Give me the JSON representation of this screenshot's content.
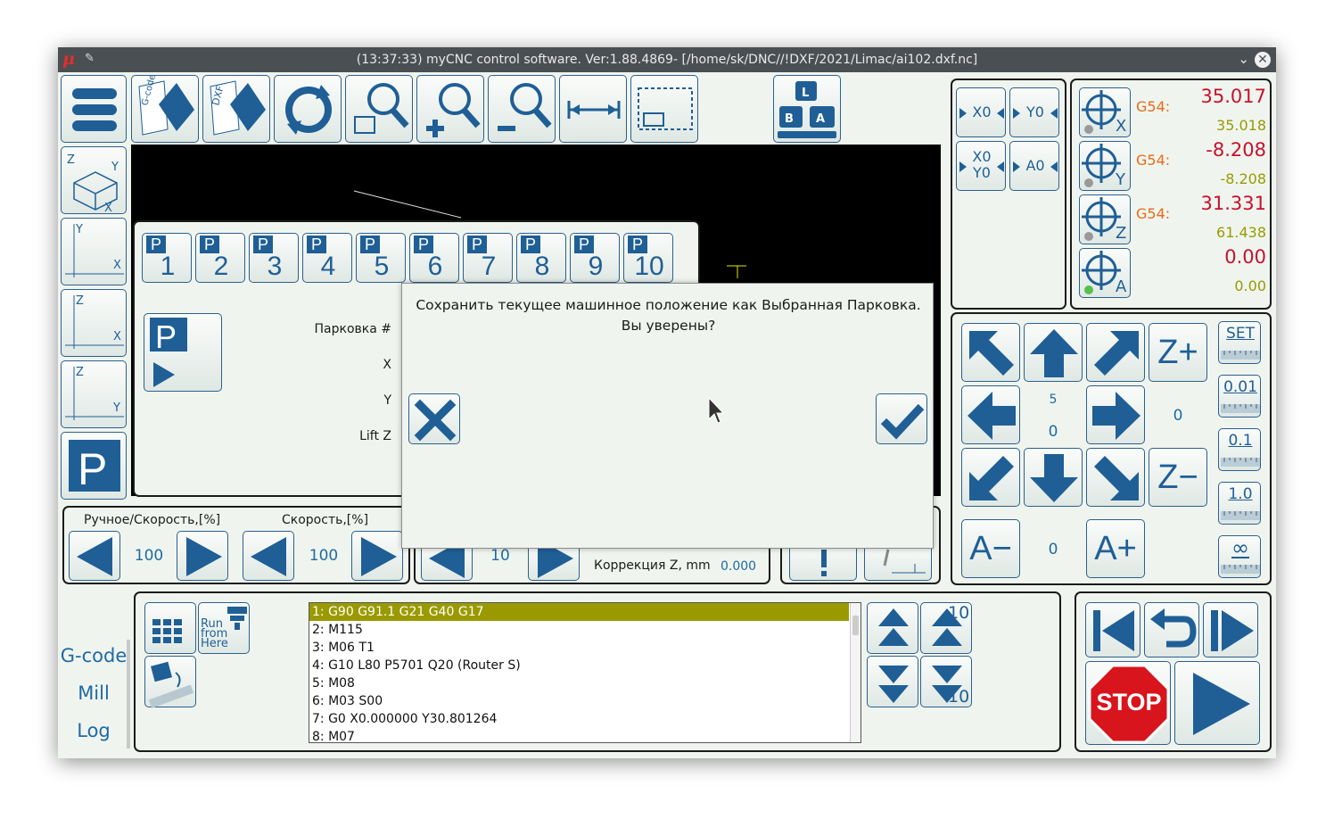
{
  "window": {
    "title": "(13:37:33) myCNC control software. Ver:1.88.4869- [/home/sk/DNC//!DXF/2021/Limac/ai102.dxf.nc]",
    "app_icon": "mu-icon",
    "pin_icon": "pin-icon"
  },
  "parking_buttons": [
    "1",
    "2",
    "3",
    "4",
    "5",
    "6",
    "7",
    "8",
    "9",
    "10"
  ],
  "parking_prefix": "P",
  "parking_panel": {
    "fields": [
      "Парковка #",
      "X",
      "Y",
      "Lift Z"
    ]
  },
  "dialog": {
    "message": "Сохранить текущее машинное положение как Выбранная Парковка. Вы уверены?",
    "cancel_icon": "close-icon",
    "confirm_icon": "check-icon"
  },
  "speed": {
    "manual_label": "Ручное/Скорость,[%]",
    "manual_value": "100",
    "speed_label": "Скорость,[%]",
    "speed_value": "100",
    "feed_value": "10",
    "z_correction_label": "Коррекция Z, mm",
    "z_correction_value": "0.000"
  },
  "dro": [
    {
      "axis": "X",
      "label": "G54:",
      "value": "35.017",
      "machine": "35.018",
      "led": "gray"
    },
    {
      "axis": "Y",
      "label": "G54:",
      "value": "-8.208",
      "machine": "-8.208",
      "led": "gray"
    },
    {
      "axis": "Z",
      "label": "G54:",
      "value": "31.331",
      "machine": "61.438",
      "led": "gray"
    },
    {
      "axis": "A",
      "label": "",
      "value": "0.00",
      "machine": "0.00",
      "led": "green"
    }
  ],
  "zero_buttons": [
    "X0",
    "Y0",
    "X0 Y0",
    "A0"
  ],
  "jog": {
    "step_small": "5",
    "xy_value": "0",
    "z_value": "0",
    "a_value": "0",
    "z_plus": "Z+",
    "z_minus": "Z−",
    "a_plus": "A+",
    "a_minus": "A−",
    "steps": [
      "SET",
      "0.01",
      "0.1",
      "1.0",
      "∞"
    ]
  },
  "side_tabs": [
    "G-code",
    "Mill",
    "Log"
  ],
  "gcode_tools": {
    "run_from_here": [
      "Run",
      "from",
      "Here"
    ]
  },
  "gcode_lines": [
    "1: G90 G91.1 G21 G40 G17",
    "2: M115",
    "3: M06 T1",
    "4: G10 L80 P5701 Q20 (Router S)",
    "5: M08",
    "6: M03 S00",
    "7: G0 X0.000000 Y30.801264",
    "8: M07"
  ],
  "scroll_step_labels": [
    "10",
    "10"
  ],
  "run_controls": {
    "stop_label": "STOP"
  },
  "colors": {
    "accent": "#1f6aa5",
    "dro_red": "#c8102e",
    "dro_olive": "#9a9a00",
    "g54_orange": "#ea6a1a",
    "highlight": "#9a9a00"
  }
}
